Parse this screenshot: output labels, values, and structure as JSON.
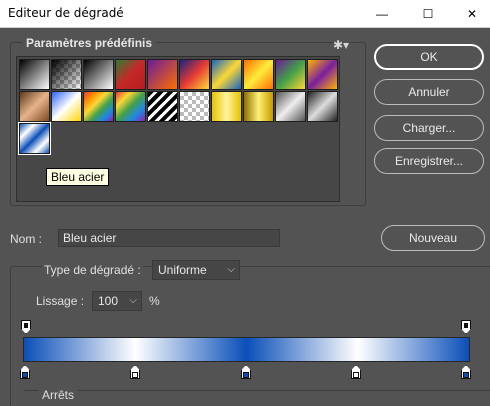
{
  "window": {
    "title": "Editeur de dégradé",
    "minimize_glyph": "—",
    "maximize_glyph": "☐",
    "close_glyph": "✕"
  },
  "presets": {
    "title": "Paramètres prédéfinis",
    "gear_glyph": "✱▾",
    "tooltip": "Bleu acier"
  },
  "buttons": {
    "ok": "OK",
    "cancel": "Annuler",
    "load": "Charger...",
    "save": "Enregistrer...",
    "new": "Nouveau"
  },
  "name": {
    "label": "Nom :",
    "value": "Bleu acier"
  },
  "gradient_type": {
    "label": "Type de dégradé :",
    "value": "Uniforme"
  },
  "smoothness": {
    "label": "Lissage :",
    "value": "100",
    "unit": "%"
  },
  "stops_title": "Arrêts",
  "colors": {
    "steel_dark": "#0b4fb8",
    "steel_light": "#ffffff",
    "stop_outline": "#111111"
  }
}
